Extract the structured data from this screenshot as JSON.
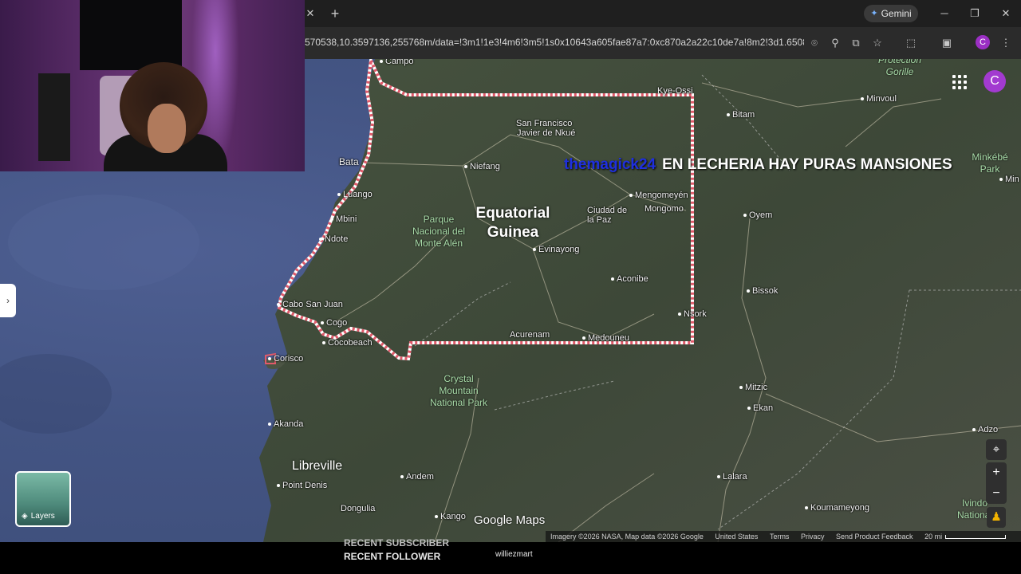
{
  "browser": {
    "gemini_label": "Gemini",
    "url": "570538,10.3597136,255768m/data=!3m1!1e3!4m6!3m5!1s0x10643a605fae87a7:0xc870a2a22c10de7a!8m2!3d1.650801!...",
    "profile_initial": "C",
    "window_controls": {
      "minimize": "─",
      "restore": "❐",
      "close": "✕"
    }
  },
  "map": {
    "country_name": "Equatorial Guinea",
    "parks": [
      "Parque Nacional del Monte Alén",
      "Crystal Mountain National Park",
      "Protection Gorille",
      "Minkébé Park"
    ],
    "places": [
      "Campo",
      "Kye-Ossi",
      "Minvoul",
      "Bitam",
      "San Francisco",
      "Javier de Nkué",
      "Bata",
      "Niefang",
      "Luango",
      "Mbini",
      "Ndote",
      "Mengomeyén",
      "Mongomo",
      "Ciudad de la Paz",
      "Oyem",
      "Evinayong",
      "Aconibe",
      "Cabo San Juan",
      "Bissok",
      "Cogo",
      "Nsork",
      "Cocobeach",
      "Acurenam",
      "Medouneu",
      "Corisco",
      "Mitzic",
      "Ekan",
      "Akanda",
      "Libreville",
      "Point Denis",
      "Andem",
      "Lalara",
      "Adzo",
      "Dongulia",
      "Kango",
      "Koumameyong",
      "Ivindo National",
      "Min"
    ],
    "account_initial": "C",
    "layers_label": "Layers",
    "logo_text": "Google Maps",
    "attribution": {
      "imagery": "Imagery ©2026 NASA, Map data ©2026 Google",
      "region": "United States",
      "terms": "Terms",
      "privacy": "Privacy",
      "feedback": "Send Product Feedback",
      "scale": "20 mi"
    }
  },
  "stream": {
    "chat_user": "themagick24",
    "chat_message": "EN LECHERIA HAY PURAS MANSIONES",
    "recent_subscriber_label": "RECENT SUBSCRIBER",
    "recent_follower_label": "RECENT FOLLOWER",
    "recent_follower_name": "williezmart"
  },
  "colors": {
    "ocean": "#435483",
    "land": "#3f4a3a",
    "border": "#ffffff",
    "border_dash": "#e05a6a",
    "avatar": "#a23ad0",
    "chat_user": "#1e2fe0"
  }
}
